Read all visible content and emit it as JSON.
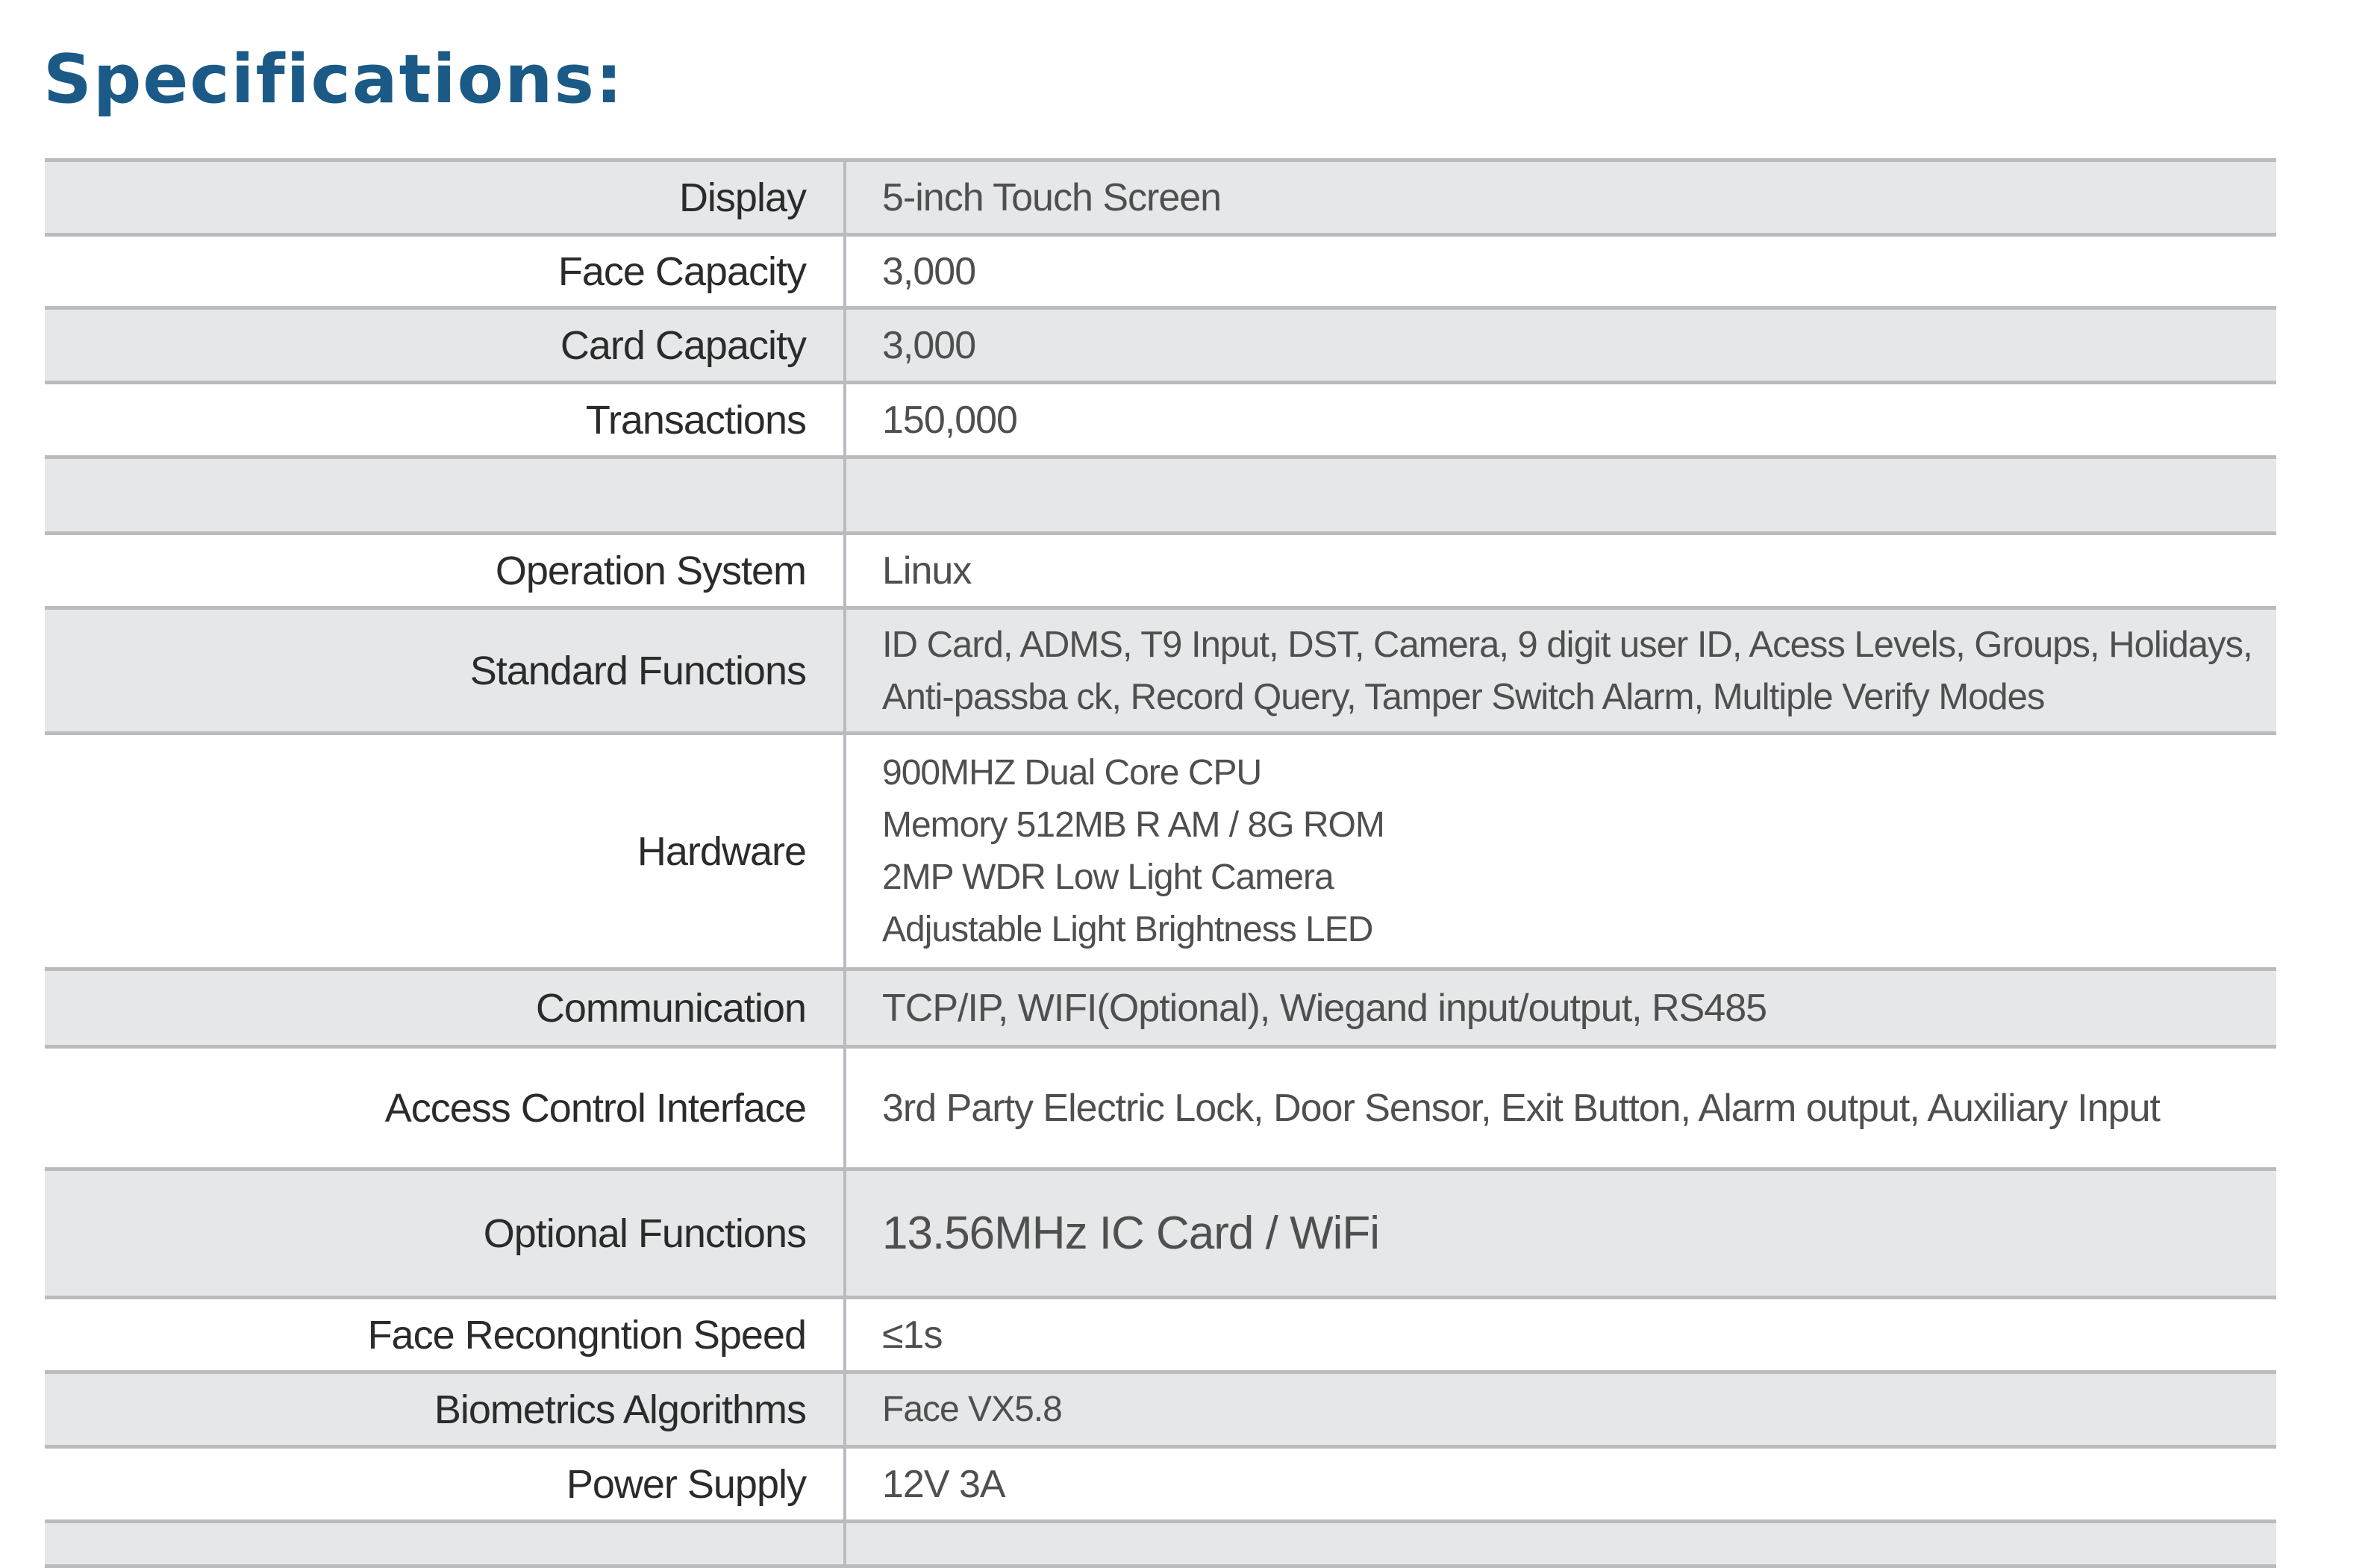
{
  "title": "Specifications:",
  "rows": [
    {
      "label": "Display",
      "value": "5-inch Touch Screen"
    },
    {
      "label": "Face Capacity",
      "value": "3,000"
    },
    {
      "label": "Card Capacity",
      "value": "3,000"
    },
    {
      "label": "Transactions",
      "value": "150,000"
    },
    {
      "label": "",
      "value": ""
    },
    {
      "label": "Operation System",
      "value": "Linux"
    },
    {
      "label": "Standard Functions",
      "lines": [
        "ID Card, ADMS, T9 Input, DST, Camera, 9 digit user ID, Acess Levels, Groups, Holidays,",
        "Anti-passba ck, Record Query, Tamper Switch Alarm, Multiple Verify Modes"
      ]
    },
    {
      "label": "Hardware",
      "lines": [
        "900MHZ Dual  Core CPU",
        "Memory 512MB R AM / 8G ROM",
        "2MP WDR Low Light Camera",
        "Adjustable  Light Brightness LED"
      ]
    },
    {
      "label": "Communication",
      "value": "TCP/IP, WIFI(Optional), Wiegand input/output, RS485"
    },
    {
      "label": "Access Control Interface",
      "value": "3rd Party Electric Lock, Door Sensor, Exit Button, Alarm output, Auxiliary Input"
    },
    {
      "label": "Optional Functions",
      "value": "13.56MHz IC Card / WiFi"
    },
    {
      "label": "Face Recongntion Speed",
      "value": "≤1s"
    },
    {
      "label": "Biometrics Algorithms",
      "value": "Face VX5.8"
    },
    {
      "label": "Power Supply",
      "value": "12V 3A"
    }
  ]
}
